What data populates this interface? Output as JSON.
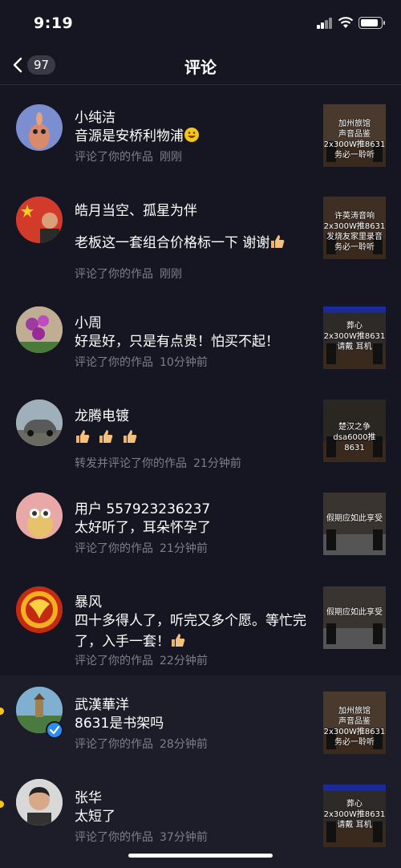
{
  "status_bar": {
    "time": "9:19"
  },
  "nav": {
    "back_count": "97",
    "title": "评论"
  },
  "comments": [
    {
      "name": "小纯洁",
      "text": "音源是安桥利物浦",
      "meta": "评论了你的作品",
      "time": "刚刚",
      "thumb": "加州旅馆\n声音品鉴\n2x300W推8631\n务必一聆听",
      "unread": false,
      "emojis": [
        "grin"
      ]
    },
    {
      "name": "皓月当空、孤星为伴",
      "text": "老板这一套组合价格标一下 谢谢",
      "meta": "评论了你的作品",
      "time": "刚刚",
      "thumb": "许英涛音响\n2x300W推8631\n发烧友家里录音\n务必一聆听",
      "unread": false,
      "emojis": [
        "thumb"
      ]
    },
    {
      "name": "小周",
      "text": "好是好，只是有点贵！怕买不起！",
      "meta": "评论了你的作品",
      "time": "10分钟前",
      "thumb": "葬心\n2x300W推8631\n请戴 耳机",
      "unread": false,
      "emojis": []
    },
    {
      "name": "龙腾电镀",
      "text": "",
      "meta": "转发并评论了你的作品",
      "time": "21分钟前",
      "thumb": "楚汉之争\ndsa6000推8631",
      "unread": false,
      "emojis": [
        "thumb",
        "thumb",
        "thumb"
      ]
    },
    {
      "name": "用户 557923236237",
      "text": "太好听了，耳朵怀孕了",
      "meta": "评论了你的作品",
      "time": "21分钟前",
      "thumb": "假期应如此享受",
      "unread": false,
      "emojis": []
    },
    {
      "name": "暴风",
      "text": "四十多得人了，听完又多个愿。等忙完了，入手一套！",
      "meta": "评论了你的作品",
      "time": "22分钟前",
      "thumb": "假期应如此享受",
      "unread": false,
      "emojis": [
        "thumb"
      ]
    },
    {
      "name": "武漢華洋",
      "text": "8631是书架吗",
      "meta": "评论了你的作品",
      "time": "28分钟前",
      "thumb": "加州旅馆\n声音品鉴\n2x300W推8631\n务必一聆听",
      "unread": true,
      "emojis": []
    },
    {
      "name": "张华",
      "text": "太短了",
      "meta": "评论了你的作品",
      "time": "37分钟前",
      "thumb": "葬心\n2x300W推8631\n请戴 耳机",
      "unread": true,
      "emojis": []
    }
  ],
  "colors": {
    "background": "#161622",
    "secondary_text": "#7f7f8c",
    "unread_dot": "#f5c518",
    "verified": "#2d8cf0"
  }
}
